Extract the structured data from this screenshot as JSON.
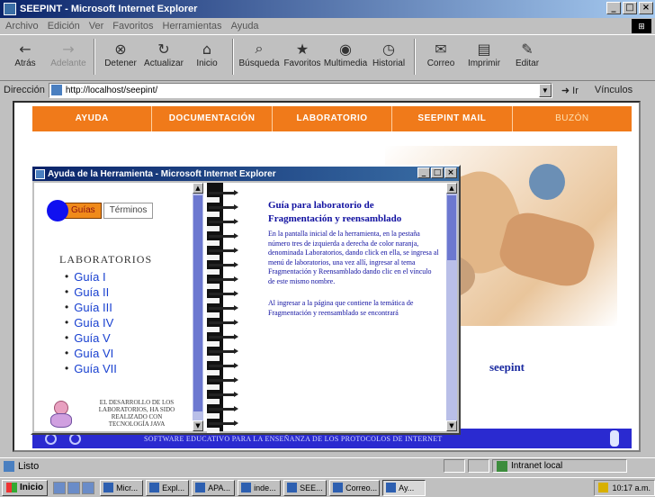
{
  "window": {
    "title": "SEEPINT - Microsoft Internet Explorer",
    "buttons": {
      "minimize": "_",
      "maximize": "□",
      "close": "×"
    }
  },
  "menubar": [
    "Archivo",
    "Edición",
    "Ver",
    "Favoritos",
    "Herramientas",
    "Ayuda"
  ],
  "toolbar": {
    "buttons": [
      {
        "label": "Atrás",
        "icon": "back-arrow-icon",
        "glyph": "←",
        "disabled": false
      },
      {
        "label": "Adelante",
        "icon": "forward-arrow-icon",
        "glyph": "→",
        "disabled": true
      },
      {
        "label": "Detener",
        "icon": "stop-icon",
        "glyph": "⊗",
        "disabled": false
      },
      {
        "label": "Actualizar",
        "icon": "refresh-icon",
        "glyph": "↻",
        "disabled": false
      },
      {
        "label": "Inicio",
        "icon": "home-icon",
        "glyph": "⌂",
        "disabled": false
      },
      {
        "label": "Búsqueda",
        "icon": "search-icon",
        "glyph": "⌕",
        "disabled": false
      },
      {
        "label": "Favoritos",
        "icon": "favorites-icon",
        "glyph": "★",
        "disabled": false
      },
      {
        "label": "Multimedia",
        "icon": "media-icon",
        "glyph": "◉",
        "disabled": false
      },
      {
        "label": "Historial",
        "icon": "history-icon",
        "glyph": "◷",
        "disabled": false
      },
      {
        "label": "Correo",
        "icon": "mail-icon",
        "glyph": "✉",
        "disabled": false
      },
      {
        "label": "Imprimir",
        "icon": "print-icon",
        "glyph": "▤",
        "disabled": false
      },
      {
        "label": "Editar",
        "icon": "edit-icon",
        "glyph": "✎",
        "disabled": false
      }
    ]
  },
  "address": {
    "label": "Dirección",
    "url": "http://localhost/seepint/",
    "go": "Ir",
    "links": "Vínculos"
  },
  "site": {
    "nav": [
      "AYUDA",
      "DOCUMENTACIÓN",
      "LABORATORIO",
      "SEEPINT MAIL",
      "BUZÓN"
    ],
    "wordmark": "seepint",
    "footer_text": "SOFTWARE EDUCATIVO PARA LA ENSEÑANZA DE LOS PROTOCOLOS DE INTERNET"
  },
  "popup": {
    "title": "Ayuda de la Herramienta - Microsoft Internet Explorer",
    "tabs": [
      "Guías",
      "Términos"
    ],
    "heading": "LABORATORIOS",
    "guides": [
      "Guía I",
      "Guía II",
      "Guía III",
      "Guía IV",
      "Guía V",
      "Guía VI",
      "Guía VII"
    ],
    "caption": "EL DESARROLLO DE LOS LABORATORIOS, HA SIDO REALIZADO CON TECNOLOGÍA JAVA",
    "doc_title": "Guía para laboratorio de Fragmentación y reensamblado",
    "doc_p1": "En la pantalla inicial de la herramienta, en la pestaña número tres de izquierda a derecha de color naranja, denominada Laboratorios, dando click en ella, se ingresa al menú de laboratorios, una vez allí, ingresar al tema Fragmentación y Reensamblado dando clic en el vínculo de este mismo nombre.",
    "doc_p2": "Al ingresar a la página que contiene la temática de Fragmentación y reensamblado se encontrará"
  },
  "statusbar": {
    "text": "Listo",
    "zone": "Intranet local"
  },
  "taskbar": {
    "start": "Inicio",
    "tasks": [
      "Micr...",
      "Expl...",
      "APA...",
      "inde...",
      "SEE...",
      "Correo...",
      "Ay..."
    ],
    "clock": "10:17 a.m."
  }
}
